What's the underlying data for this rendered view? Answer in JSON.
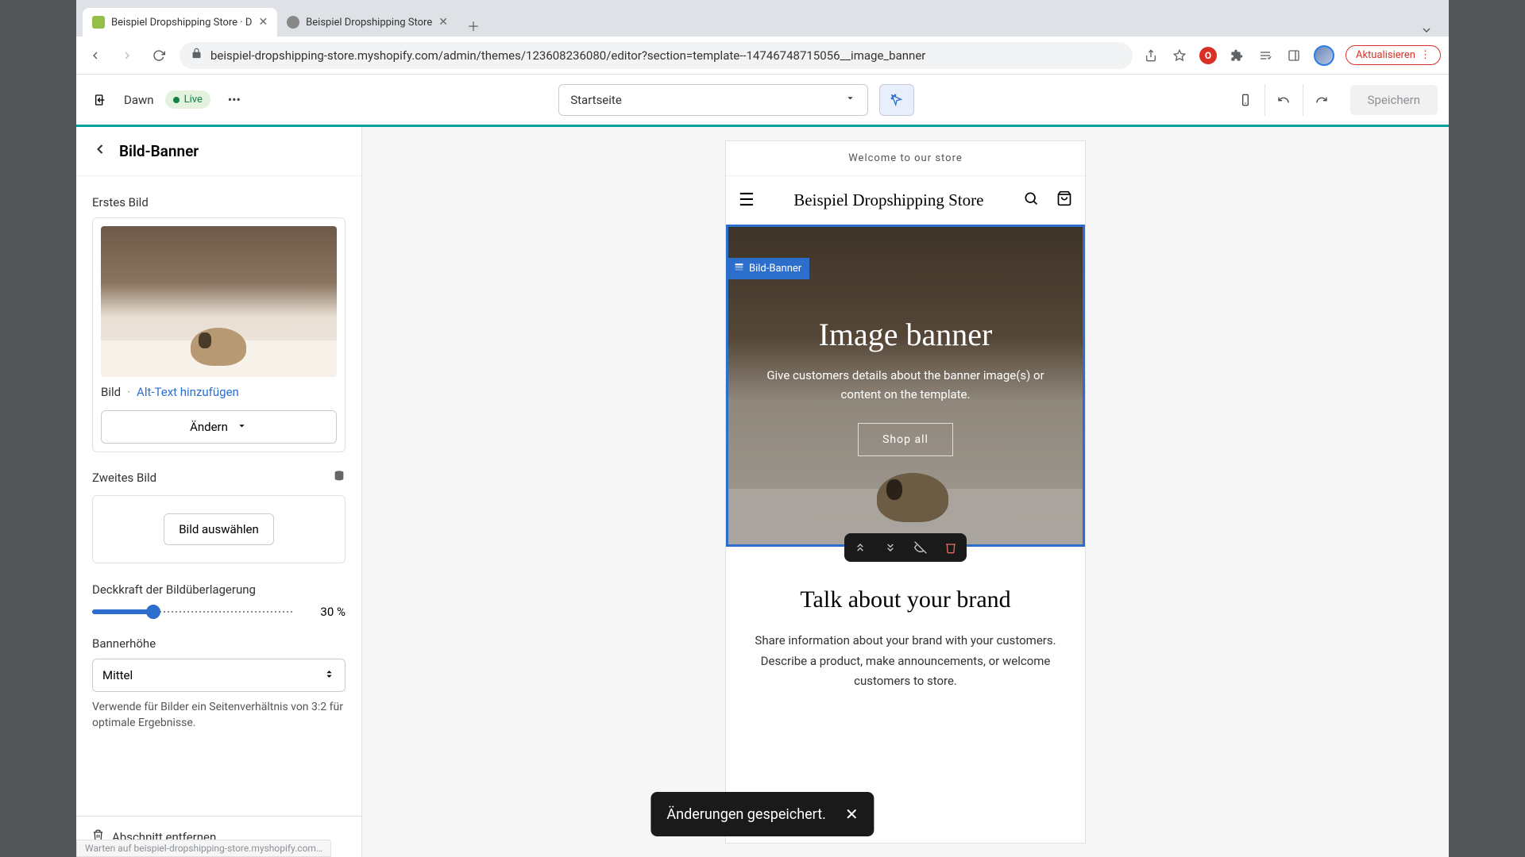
{
  "browser": {
    "tabs": [
      {
        "title": "Beispiel Dropshipping Store · D",
        "active": true
      },
      {
        "title": "Beispiel Dropshipping Store",
        "active": false
      }
    ],
    "url": "beispiel-dropshipping-store.myshopify.com/admin/themes/123608236080/editor?section=template--14746748715056__image_banner",
    "update_label": "Aktualisieren"
  },
  "toolbar": {
    "theme_name": "Dawn",
    "live_label": "Live",
    "page_selector": "Startseite",
    "save_label": "Speichern"
  },
  "sidebar": {
    "title": "Bild-Banner",
    "first_image_label": "Erstes Bild",
    "image_meta_label": "Bild",
    "alt_text_link": "Alt-Text hinzufügen",
    "change_label": "Ändern",
    "second_image_label": "Zweites Bild",
    "select_image_label": "Bild auswählen",
    "opacity_label": "Deckkraft der Bildüberlagerung",
    "opacity_value": "30 %",
    "height_label": "Bannerhöhe",
    "height_value": "Mittel",
    "height_hint": "Verwende für Bilder ein Seitenverhältnis von 3:2 für optimale Ergebnisse.",
    "remove_label": "Abschnitt entfernen"
  },
  "preview": {
    "announcement": "Welcome to our store",
    "store_name": "Beispiel Dropshipping Store",
    "section_tag": "Bild-Banner",
    "banner_title": "Image banner",
    "banner_text": "Give customers details about the banner image(s) or content on the template.",
    "shop_button": "Shop all",
    "rich_title": "Talk about your brand",
    "rich_text": "Share information about your brand with your customers. Describe a product, make announcements, or welcome customers to store."
  },
  "toast": {
    "message": "Änderungen gespeichert."
  },
  "status": "Warten auf beispiel-dropshipping-store.myshopify.com…"
}
